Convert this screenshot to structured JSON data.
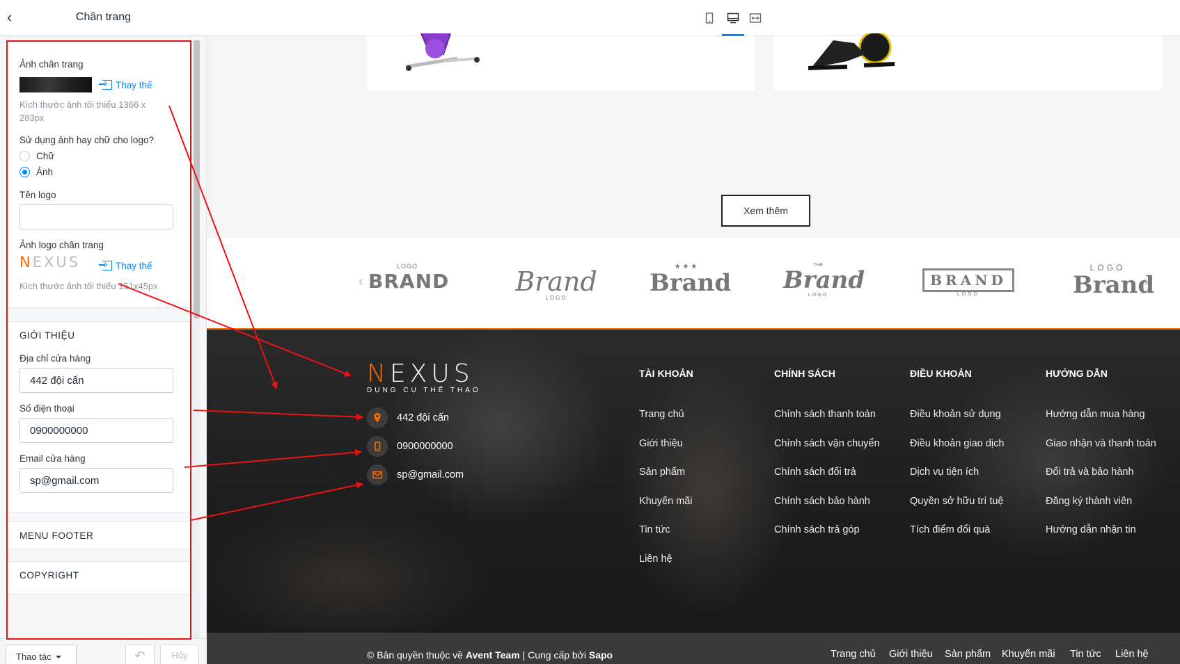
{
  "sidebar": {
    "title": "Chân trang",
    "footer_image": {
      "label": "Ảnh chân trang",
      "replace": "Thay thế",
      "hint": "Kích thước ảnh tối thiểu 1366 x 283px"
    },
    "logo_type": {
      "label": "Sử dụng ảnh hay chữ cho logo?",
      "options": [
        "Chữ",
        "Ảnh"
      ],
      "selected": "Ảnh"
    },
    "logo_name": {
      "label": "Tên logo",
      "value": ""
    },
    "footer_logo": {
      "label": "Ảnh logo chân trang",
      "thumb_n": "N",
      "thumb_rest": "EXUS",
      "replace": "Thay thế",
      "hint": "Kích thước ảnh tối thiểu 151x45px"
    },
    "intro": {
      "title": "GIỚI THIỆU",
      "address_label": "Địa chỉ cửa hàng",
      "address_value": "442 đội cấn",
      "phone_label": "Số điện thoại",
      "phone_value": "0900000000",
      "email_label": "Email cửa hàng",
      "email_value": "sp@gmail.com"
    },
    "menu_footer": "MENU FOOTER",
    "copyright": "COPYRIGHT",
    "actions": "Thao tác",
    "undo": "↶",
    "cancel": "Hủy"
  },
  "preview": {
    "more_button": "Xem thêm",
    "brands": [
      {
        "top": "LOGO",
        "main": "BRAND"
      },
      {
        "top": "",
        "main": "Brand",
        "sub": "LOGO"
      },
      {
        "top": "★ ★ ★",
        "main": "Brand"
      },
      {
        "top": "THE",
        "main": "Brand",
        "sub": "LOGO"
      },
      {
        "top": "",
        "main": "BRAND",
        "sub": "LOGO"
      },
      {
        "top": "LOGO",
        "main": "Brand"
      }
    ],
    "footer": {
      "logo_n": "N",
      "logo_rest": "EXUS",
      "logo_tagline": "DỤNG CỤ THỂ THAO",
      "address": "442 đội cấn",
      "phone": "0900000000",
      "email": "sp@gmail.com",
      "columns": [
        {
          "title": "TÀI KHOẢN",
          "links": [
            "Trang chủ",
            "Giới thiệu",
            "Sản phẩm",
            "Khuyến mãi",
            "Tin tức",
            "Liên hệ"
          ]
        },
        {
          "title": "CHÍNH SÁCH",
          "links": [
            "Chính sách thanh toán",
            "Chính sách vận chuyển",
            "Chính sách đổi trả",
            "Chính sách bảo hành",
            "Chính sách trả góp"
          ]
        },
        {
          "title": "ĐIỀU KHOẢN",
          "links": [
            "Điều khoản sử dụng",
            "Điều khoản giao dịch",
            "Dịch vụ tiện ích",
            "Quyền sở hữu trí tuệ",
            "Tích điểm đổi quà"
          ]
        },
        {
          "title": "HƯỚNG DẪN",
          "links": [
            "Hướng dẫn mua hàng",
            "Giao nhận và thanh toán",
            "Đổi trả và bảo hành",
            "Đăng ký thành viên",
            "Hướng dẫn nhận tin"
          ]
        }
      ],
      "copyright_prefix": "© Bản quyền thuộc về ",
      "copyright_owner": "Avent Team",
      "copyright_mid": " | Cung cấp bởi ",
      "copyright_provider": "Sapo",
      "bottom_links": [
        "Trang chủ",
        "Giới thiệu",
        "Sản phẩm",
        "Khuyến mãi",
        "Tin tức",
        "Liên hệ"
      ]
    }
  },
  "colors": {
    "accent": "#0088ff",
    "brand_orange": "#ff6a00",
    "annotation": "#ee1111"
  },
  "icons": [
    "chevron-left-icon",
    "replace-icon",
    "mobile-icon",
    "desktop-icon",
    "fullwidth-icon",
    "location-icon",
    "phone-icon",
    "mail-icon"
  ]
}
